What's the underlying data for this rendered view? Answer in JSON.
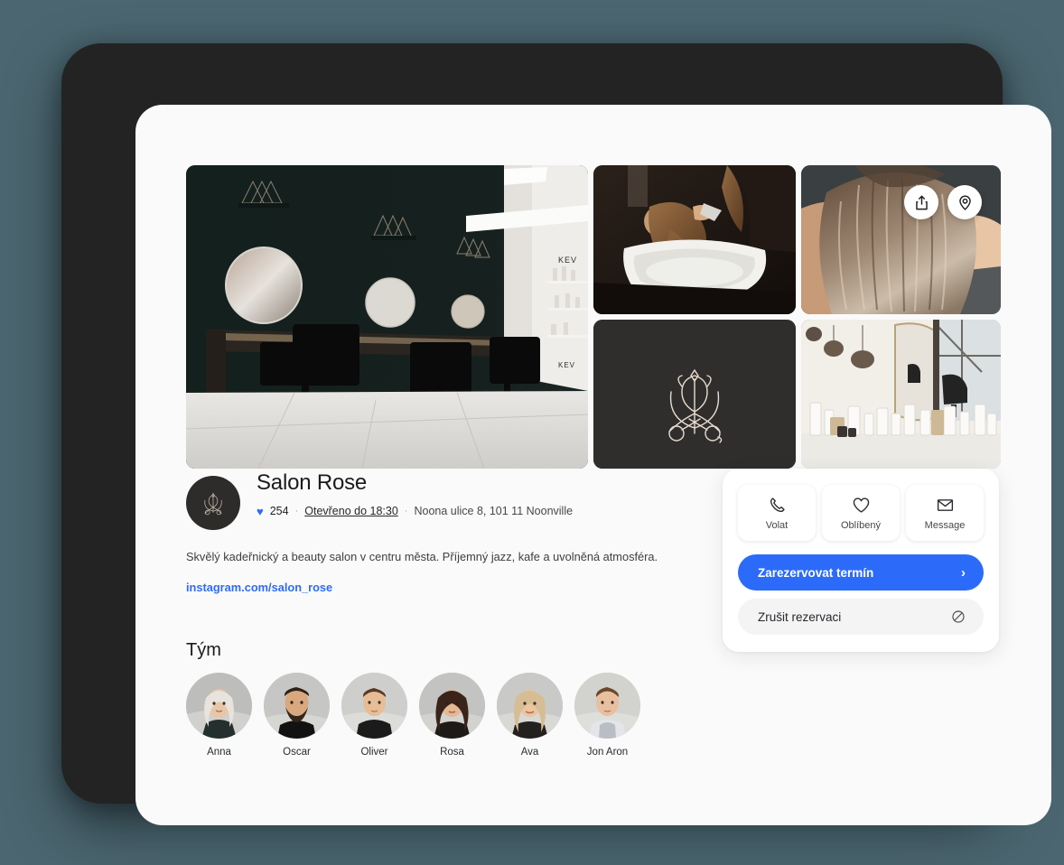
{
  "background_color": "#4b6670",
  "device": {
    "bezel_color": "#232323",
    "screen_color": "#fafafa"
  },
  "gallery": {
    "tiles": [
      {
        "name": "salon-interior-photo",
        "alt": "Dark salon interior with round mirrors and black styling chairs"
      },
      {
        "name": "hair-washing-photo",
        "alt": "Stylist washing client hair at basin"
      },
      {
        "name": "balayage-hair-photo",
        "alt": "Back of head with blonde balayage highlights"
      },
      {
        "name": "salon-logo-tile",
        "alt": "Dark tile with tulip and scissors logo"
      },
      {
        "name": "salon-products-photo",
        "alt": "Bright salon shelf with hair product bottles and mirror"
      }
    ],
    "float_buttons": [
      {
        "name": "share-icon",
        "label": "Share"
      },
      {
        "name": "location-pin-icon",
        "label": "Location"
      }
    ]
  },
  "salon": {
    "name": "Salon Rose",
    "likes": "254",
    "hours": "Otevřeno do 18:30",
    "address": "Noona ulice  8, 101 11 Noonville",
    "separator": "·",
    "heart_glyph": "♥",
    "description": "Skvělý kadeřnický a beauty salon v centru města. Příjemný jazz, kafe a uvolněná atmosféra.",
    "link": "instagram.com/salon_rose",
    "accent_color": "#2f6bf5"
  },
  "team": {
    "heading": "Tým",
    "members": [
      {
        "name": "Anna"
      },
      {
        "name": "Oscar"
      },
      {
        "name": "Oliver"
      },
      {
        "name": "Rosa"
      },
      {
        "name": "Ava"
      },
      {
        "name": "Jon Aron"
      }
    ]
  },
  "actions": {
    "quick": [
      {
        "label": "Volat",
        "icon": "phone-icon"
      },
      {
        "label": "Oblíbený",
        "icon": "heart-icon"
      },
      {
        "label": "Message",
        "icon": "envelope-icon"
      }
    ],
    "primary": {
      "label": "Zarezervovat termín",
      "chevron": "›",
      "color": "#2c6bfa"
    },
    "secondary": {
      "label": "Zrušit rezervaci",
      "icon": "ban-icon"
    }
  }
}
